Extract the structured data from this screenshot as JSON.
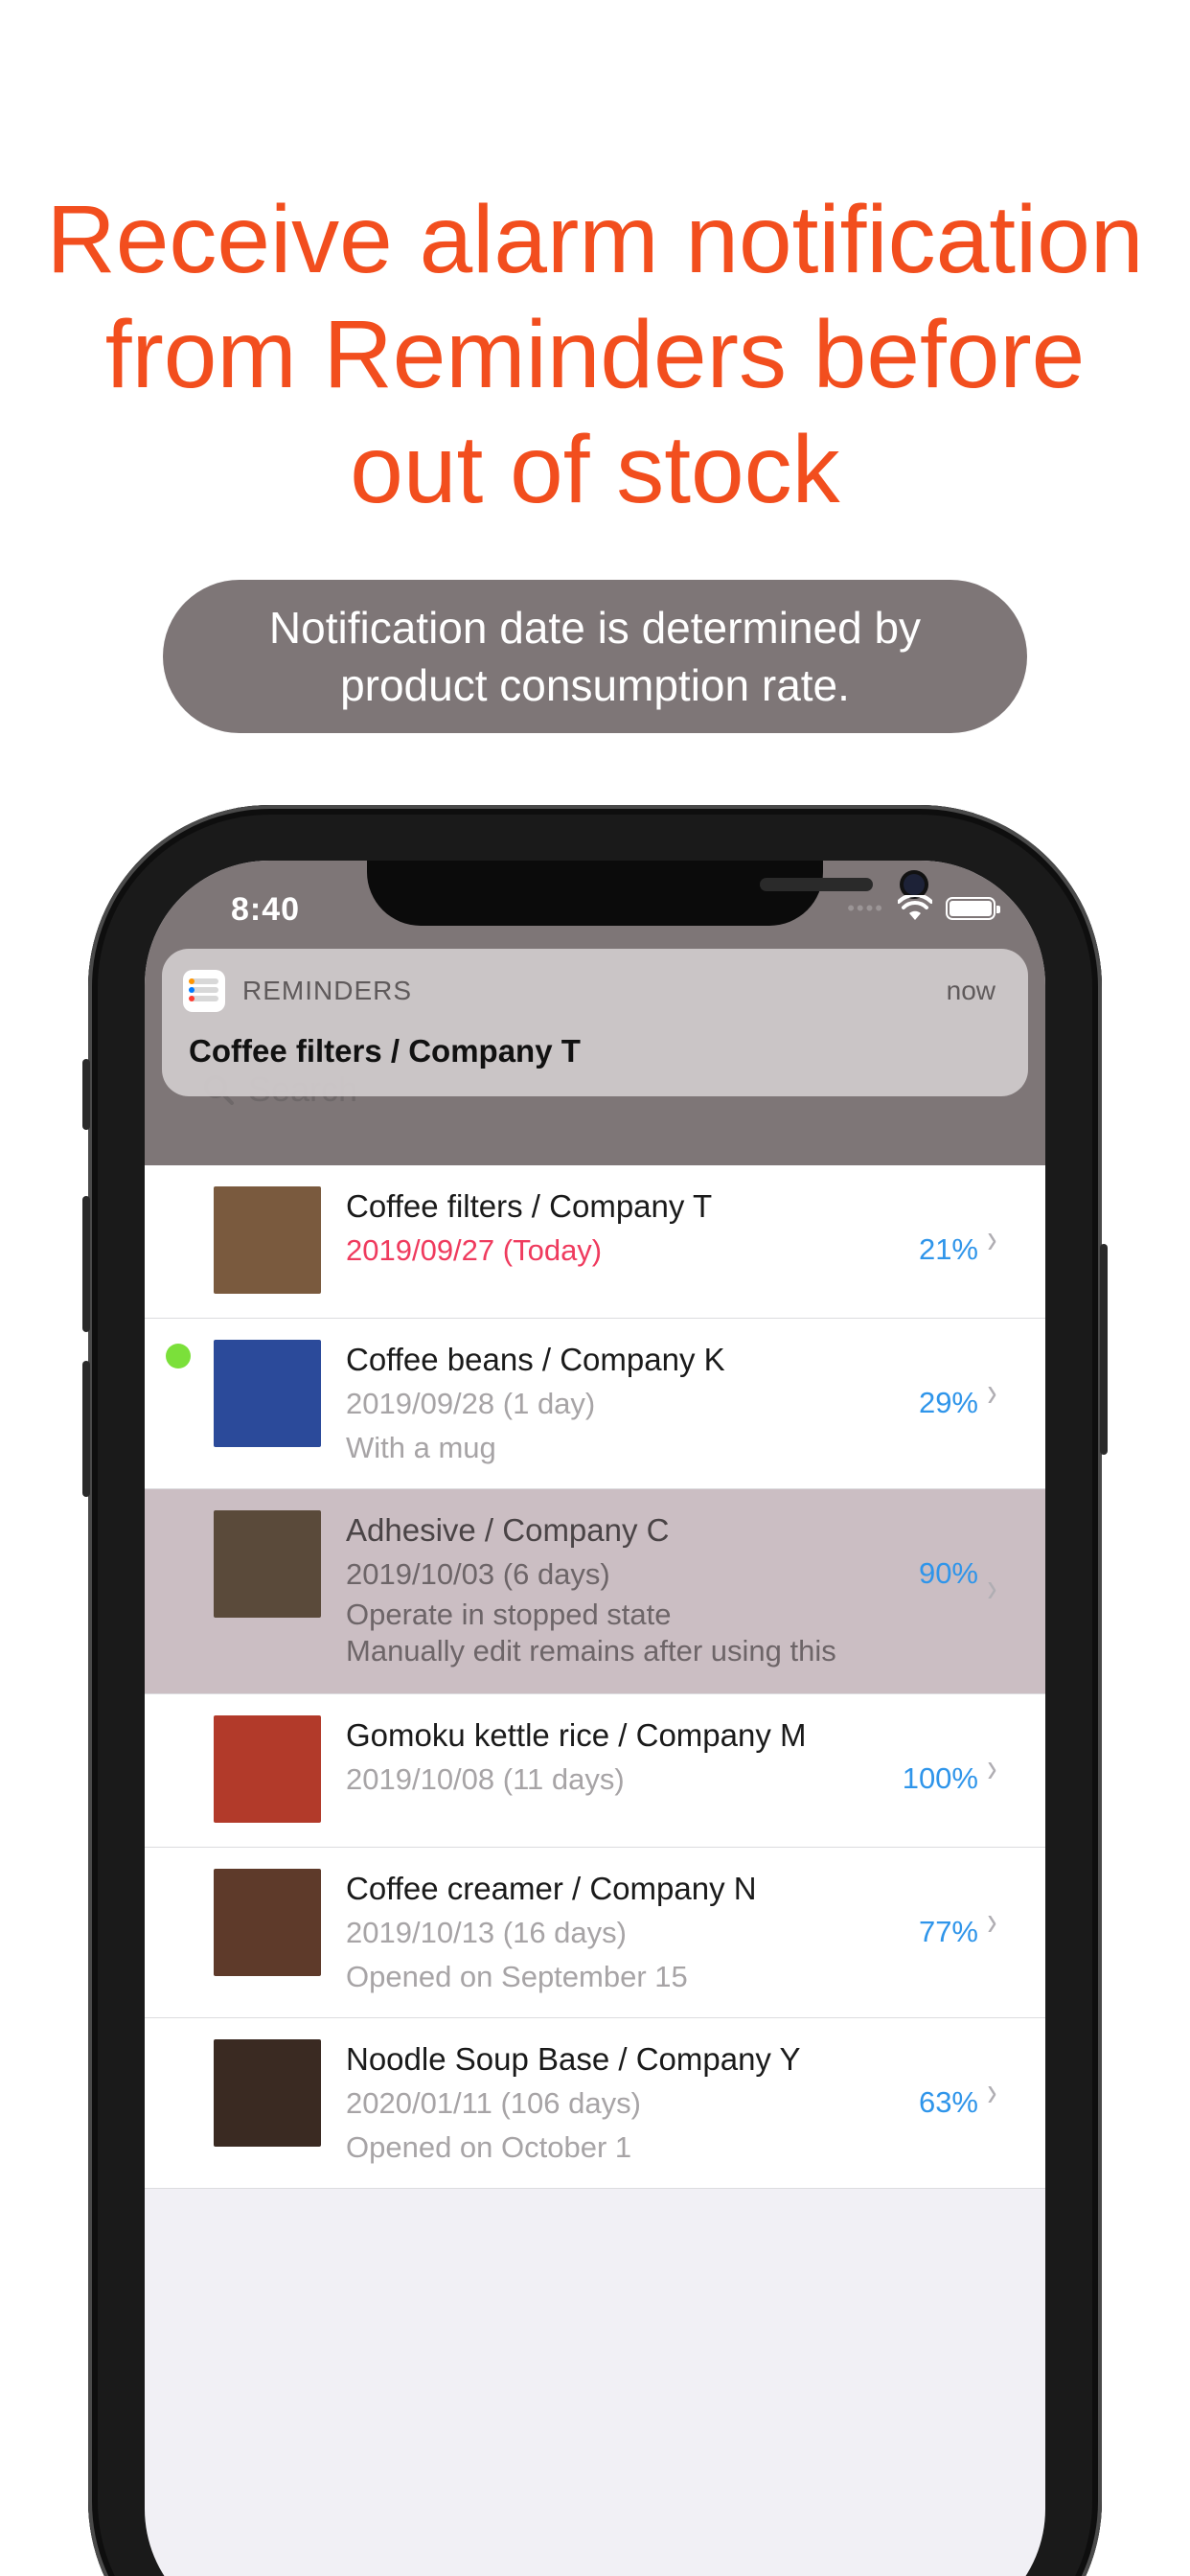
{
  "headline": {
    "line1": "Receive alarm notification",
    "line2": "from Reminders before",
    "line3": "out of stock"
  },
  "pill": {
    "line1": "Notification date is determined by",
    "line2": "product consumption rate."
  },
  "status_bar": {
    "time": "8:40"
  },
  "notification": {
    "app_name": "REMINDERS",
    "time": "now",
    "title": "Coffee filters / Company T"
  },
  "search": {
    "placeholder": "Search"
  },
  "items": [
    {
      "title": "Coffee filters / Company T",
      "date": "2019/09/27 (Today)",
      "percent": "21%",
      "notes": [],
      "thumb_color": "#7a5a3e",
      "today": true
    },
    {
      "title": "Coffee beans / Company K",
      "date": "2019/09/28 (1 day)",
      "percent": "29%",
      "notes": [
        "With a mug"
      ],
      "thumb_color": "#2b4a9a",
      "dot_color": "#7be03a"
    },
    {
      "title": "Adhesive / Company C",
      "date": "2019/10/03 (6 days)",
      "percent": "90%",
      "notes": [
        "Operate in stopped state",
        "Manually edit remains after using this"
      ],
      "thumb_color": "#5a4a3a",
      "selected": true
    },
    {
      "title": "Gomoku kettle rice / Company M",
      "date": "2019/10/08 (11 days)",
      "percent": "100%",
      "notes": [],
      "thumb_color": "#b23a2a"
    },
    {
      "title": "Coffee creamer / Company N",
      "date": "2019/10/13 (16 days)",
      "percent": "77%",
      "notes": [
        "Opened on September 15"
      ],
      "thumb_color": "#5e3a2a"
    },
    {
      "title": "Noodle Soup Base / Company Y",
      "date": "2020/01/11 (106 days)",
      "percent": "63%",
      "notes": [
        "Opened on October 1"
      ],
      "thumb_color": "#3a2a22"
    }
  ],
  "colors": {
    "accent_headline": "#f24e1e",
    "pill_bg": "#7e7677",
    "percent": "#2f95ea",
    "today": "#ef3b5e",
    "selected_row": "#cbbec3"
  }
}
